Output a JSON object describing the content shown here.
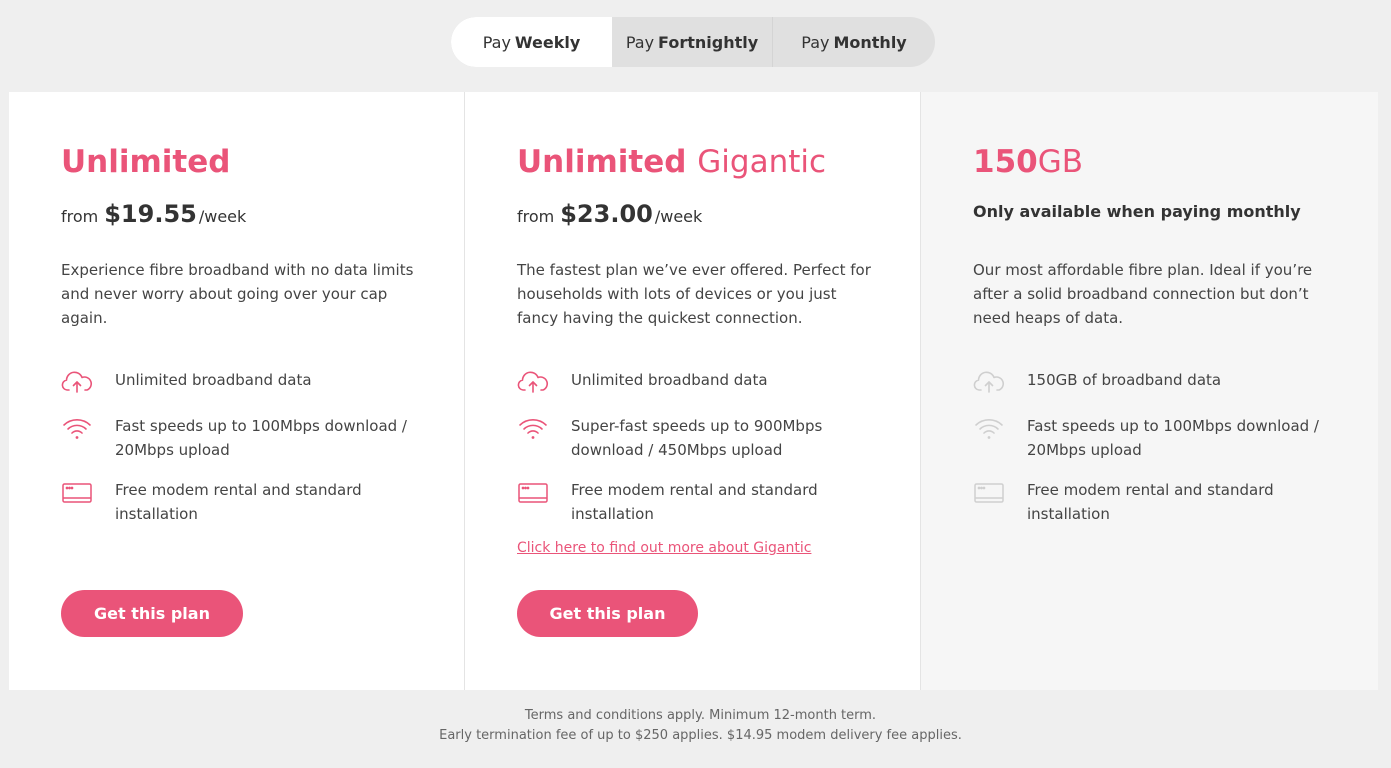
{
  "toggle": {
    "options": [
      {
        "prefix": "Pay",
        "label": "Weekly",
        "selected": true
      },
      {
        "prefix": "Pay",
        "label": "Fortnightly",
        "selected": false
      },
      {
        "prefix": "Pay",
        "label": "Monthly",
        "selected": false
      }
    ]
  },
  "plans": [
    {
      "title_bold": "Unlimited",
      "title_light": "",
      "price_prefix": "from",
      "price": "$19.55",
      "price_suffix": "/week",
      "description": "Experience fibre broadband with no data limits and never worry about going over your cap again.",
      "features": [
        {
          "icon": "cloud-upload-icon",
          "text": "Unlimited broadband data"
        },
        {
          "icon": "wifi-icon",
          "text": "Fast speeds up to 100Mbps download / 20Mbps upload"
        },
        {
          "icon": "modem-icon",
          "text": "Free modem rental and standard installation"
        }
      ],
      "button_label": "Get this plan"
    },
    {
      "title_bold": "Unlimited",
      "title_light": "Gigantic",
      "price_prefix": "from",
      "price": "$23.00",
      "price_suffix": "/week",
      "description": "The fastest plan we’ve ever offered. Perfect for households with lots of devices or you just fancy having the quickest connection.",
      "features": [
        {
          "icon": "cloud-upload-icon",
          "text": "Unlimited broadband data"
        },
        {
          "icon": "wifi-icon",
          "text": "Super-fast speeds up to 900Mbps download / 450Mbps upload"
        },
        {
          "icon": "modem-icon",
          "text": "Free modem rental and standard installation"
        }
      ],
      "link_text": "Click here to find out more about Gigantic",
      "button_label": "Get this plan"
    },
    {
      "title_bold": "150",
      "title_light": "GB",
      "availability": "Only available when paying monthly",
      "description": "Our most affordable fibre plan. Ideal if you’re after a solid broadband connection but don’t need heaps of data.",
      "features": [
        {
          "icon": "cloud-upload-icon",
          "text": "150GB of broadband data"
        },
        {
          "icon": "wifi-icon",
          "text": "Fast speeds up to 100Mbps download / 20Mbps upload"
        },
        {
          "icon": "modem-icon",
          "text": "Free modem rental and standard installation"
        }
      ]
    }
  ],
  "footer": {
    "line1": "Terms and conditions apply. Minimum 12-month term.",
    "line2": "Early termination fee of up to $250 applies. $14.95 modem delivery fee applies."
  },
  "colors": {
    "accent": "#ea5479",
    "disabled_icon": "#d0d0d0",
    "background": "#efefef"
  }
}
